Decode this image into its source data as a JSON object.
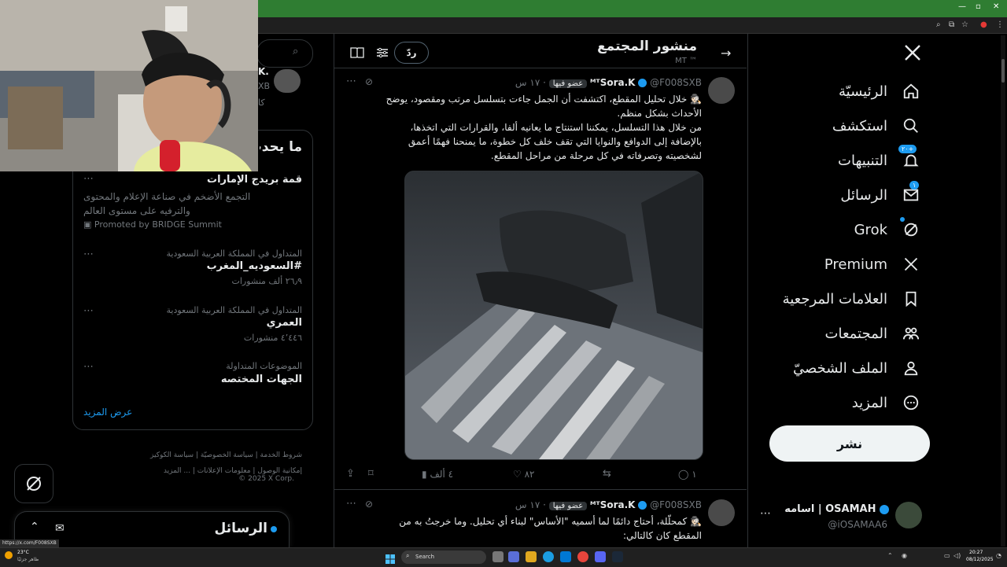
{
  "browser": {
    "status_url": "https://x.com/F008SXB"
  },
  "nav": {
    "items": [
      {
        "label": "الرئيسيّة",
        "icon": "home-icon"
      },
      {
        "label": "استكشف",
        "icon": "search-icon"
      },
      {
        "label": "التنبيهات",
        "icon": "bell-icon",
        "badge": "٢٠+"
      },
      {
        "label": "الرسائل",
        "icon": "mail-icon",
        "badge": "١"
      },
      {
        "label": "Grok",
        "icon": "grok-icon"
      },
      {
        "label": "Premium",
        "icon": "x-logo-icon"
      },
      {
        "label": "العلامات المرجعية",
        "icon": "bookmark-icon"
      },
      {
        "label": "المجتمعات",
        "icon": "communities-icon"
      },
      {
        "label": "الملف الشخصيّ",
        "icon": "profile-icon"
      },
      {
        "label": "المزيد",
        "icon": "more-icon"
      }
    ],
    "post_button": "نشر"
  },
  "account": {
    "name": "اسامه | OSAMAH",
    "handle": "@iOSAMAA6"
  },
  "header": {
    "title": "منشور المجتمع",
    "subtitle": "MT ™",
    "reply_button": "ردّ"
  },
  "tweets": [
    {
      "name": "ᴹᵀSora.K",
      "handle": "@F008SXB",
      "role": "عضو فيها",
      "time": "١٧ س",
      "text_lines": [
        "🕵🏻 خلال تحليل المقطع، اكتشفت أن الجمل جاءت بتسلسل مرتب ومقصود، يوضح",
        "الأحداث بشكل منظم.",
        "من خلال هذا التسلسل، يمكننا استنتاج ما يعانيه ألفا، والقرارات التي اتخذها،",
        "بالإضافة إلى الدوافع والنوايا التي تقف خلف كل خطوة، ما يمنحنا فهمًا أعمق",
        "لشخصيته وتصرفاته في كل مرحلة من مراحل المقطع."
      ],
      "stats": {
        "replies": "١",
        "retweets": "",
        "likes": "٨٢",
        "views": "٤ ألف"
      }
    },
    {
      "name": "ᴹᵀSora.K",
      "handle": "@F008SXB",
      "role": "عضو فيها",
      "time": "١٧ س",
      "text_lines": [
        "🕵🏻‍♀️ كمحلّلة، أحتاج دائمًا لما أسميه \"الأساس\" لبناء أي تحليل. وما خرجتُ به من",
        "المقطع كان كالتالي:"
      ]
    }
  ],
  "search": {
    "placeholder": ""
  },
  "trends": {
    "title": "ما يحدث",
    "promoted": {
      "title": "قمة بريدج الإمارات",
      "desc_line1": "التجمع الأضخم في صناعة الإعلام والمحتوى",
      "desc_line2": "والترفيه على مستوى العالم",
      "promoted_by": "Promoted by BRIDGE Summit"
    },
    "items": [
      {
        "context": "المتداول في المملكة العربية السعودية",
        "name": "#السعوديه_المغرب",
        "count": "٢٦٫٩ ألف منشورات"
      },
      {
        "context": "المتداول في المملكة العربية السعودية",
        "name": "العمري",
        "count": "٤٬٤٤٦ منشورات"
      },
      {
        "context": "الموضوعات المتداولة",
        "name": "الجهات المختصه",
        "count": ""
      }
    ],
    "show_more": "عرض المزيد"
  },
  "footer": {
    "line1": [
      "شروط الخدمة",
      "سياسة الخصوصيّة",
      "سياسة الكوكيز"
    ],
    "line2": [
      "إمكانية الوصول",
      "معلومات الإعلانات",
      "... المزيد"
    ],
    "copyright": "© 2025 X Corp."
  },
  "messages_drawer": {
    "title": "الرسائل"
  },
  "peek_user": {
    "name": "K.",
    "handle": "XB",
    "snippet": "كا"
  },
  "taskbar": {
    "weather_temp": "23°C",
    "weather_desc": "ظاهر جزئيًا",
    "search_label": "Search",
    "time": "20:27",
    "date": "08/12/2025"
  },
  "colors": {
    "accent": "#1d9bf0",
    "chrome_green": "#2f7d32"
  }
}
